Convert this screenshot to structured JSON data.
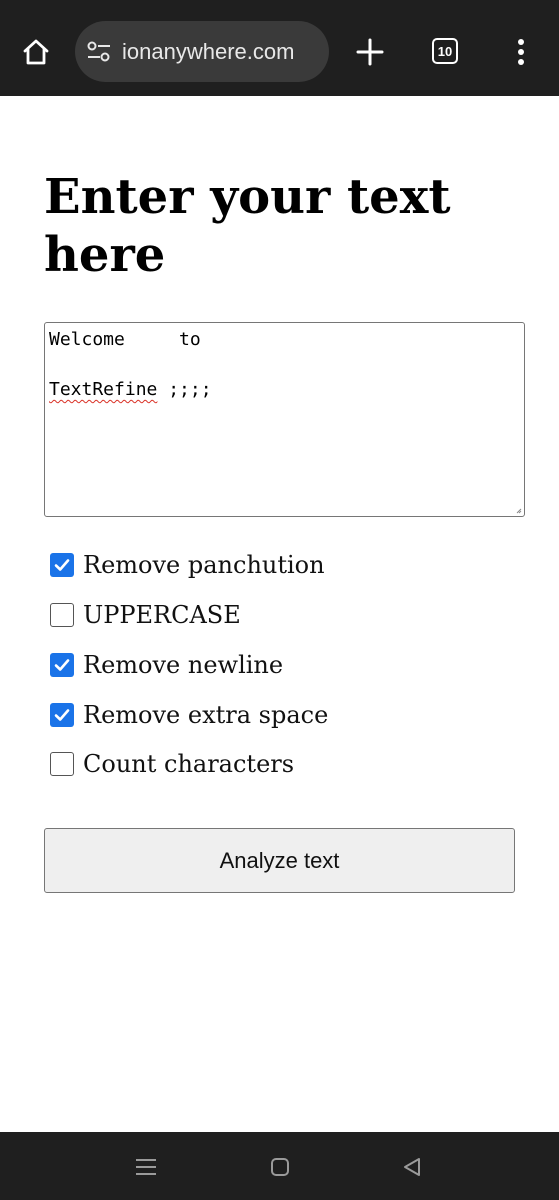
{
  "browser": {
    "url": "ionanywhere.com",
    "tab_count": "10",
    "icons": {
      "home": "home-icon",
      "site_settings": "tune-icon",
      "new_tab": "plus-icon",
      "tabs": "tab-count-icon",
      "menu": "more-vert-icon"
    }
  },
  "page": {
    "title": "Enter your text here",
    "textarea": {
      "line1": "Welcome     to",
      "line2": "",
      "line3_word": "TextRefine",
      "line3_rest": " ;;;;"
    },
    "options": [
      {
        "label": "Remove panchution",
        "checked": true
      },
      {
        "label": "UPPERCASE",
        "checked": false
      },
      {
        "label": "Remove newline",
        "checked": true
      },
      {
        "label": "Remove extra space",
        "checked": true
      },
      {
        "label": "Count characters",
        "checked": false
      }
    ],
    "analyze_label": "Analyze text"
  },
  "system_nav": {
    "icons": [
      "recents-icon",
      "home-circle-icon",
      "back-icon"
    ]
  },
  "colors": {
    "chrome_bg": "#1f1f1f",
    "url_pill": "#3a3a3a",
    "checkbox_accent": "#1a73e8",
    "spell_underline": "#d93025"
  }
}
